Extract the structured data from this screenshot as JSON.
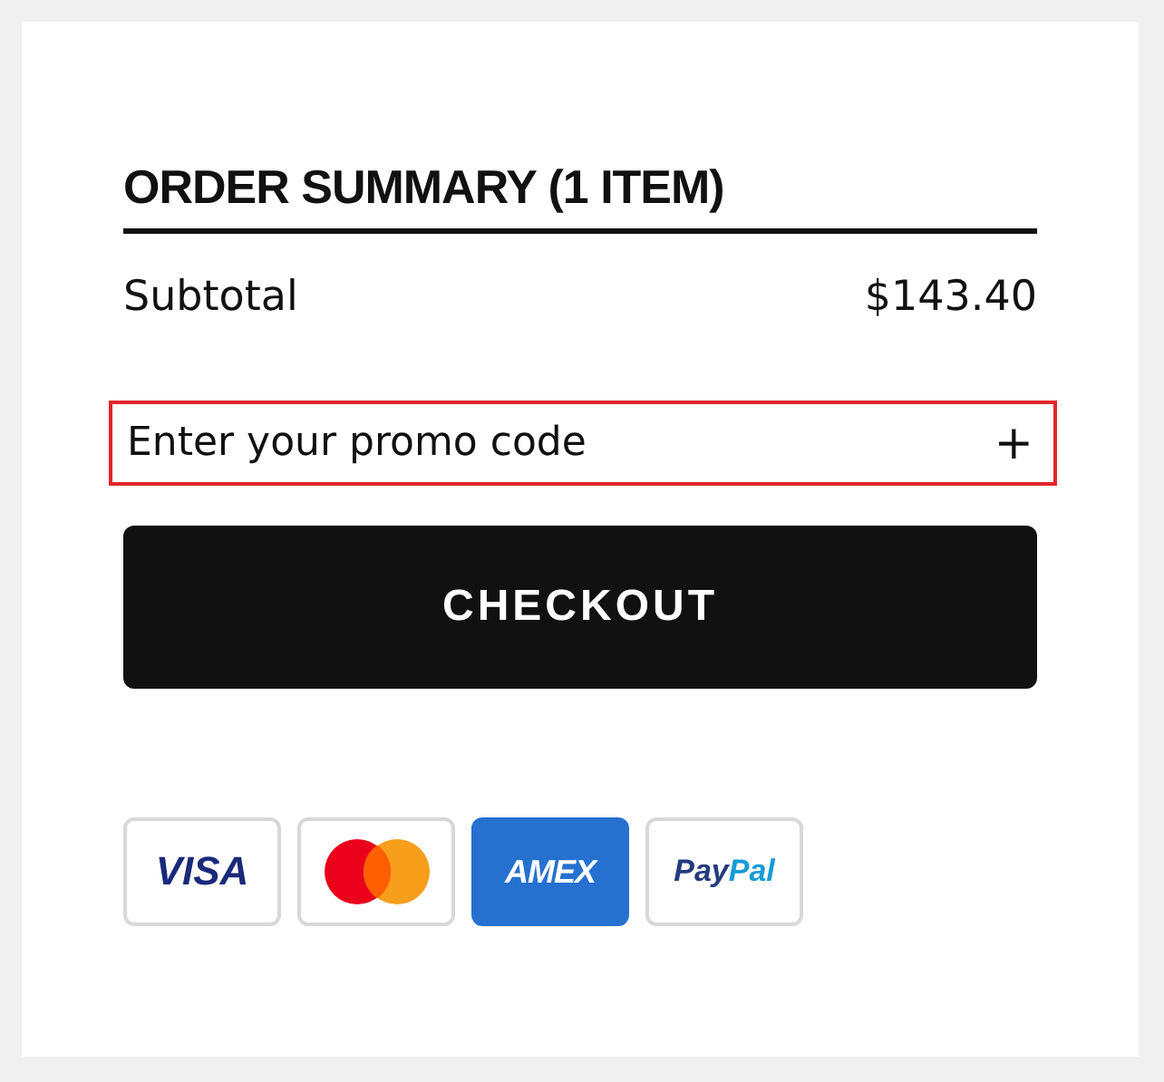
{
  "order_summary": {
    "title": "ORDER SUMMARY (1 ITEM)",
    "subtotal": {
      "label": "Subtotal",
      "value": "$143.40"
    },
    "promo": {
      "label": "Enter your promo code",
      "expand_icon": "+",
      "highlighted": true
    },
    "checkout_button": "CHECKOUT",
    "payment_methods": [
      {
        "kind": "visa",
        "label": "VISA"
      },
      {
        "kind": "mastercard"
      },
      {
        "kind": "amex",
        "label": "AMEX"
      },
      {
        "kind": "paypal",
        "label_parts": [
          "Pay",
          "Pal"
        ]
      }
    ]
  }
}
